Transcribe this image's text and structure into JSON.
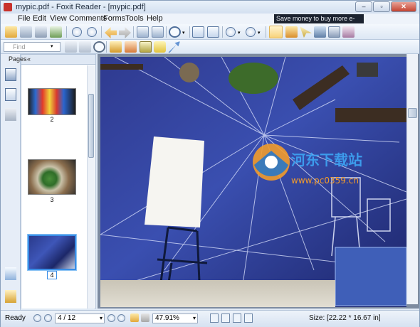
{
  "window": {
    "title": "mypic.pdf - Foxit Reader - [mypic.pdf]",
    "controls": {
      "minimize": "–",
      "maximize": "▫",
      "close": "✕"
    }
  },
  "menu": {
    "items": [
      "File",
      "Edit",
      "View",
      "Comments",
      "Forms",
      "Tools",
      "Help"
    ],
    "ad_text": "Save money to buy more e-books."
  },
  "toolbar": {
    "find_placeholder": "Find"
  },
  "panel": {
    "title": "Pages",
    "collapse_glyph": "«",
    "thumbnails": [
      {
        "label": "2"
      },
      {
        "label": "3"
      },
      {
        "label": "4",
        "selected": true
      }
    ]
  },
  "document": {
    "watermark_main": "河东下载站",
    "watermark_url": "www.pc0359.cn"
  },
  "status": {
    "ready": "Ready",
    "page_indicator": "4 / 12",
    "zoom": "47.91%",
    "size": "Size: [22.22 * 16.67 in]"
  }
}
